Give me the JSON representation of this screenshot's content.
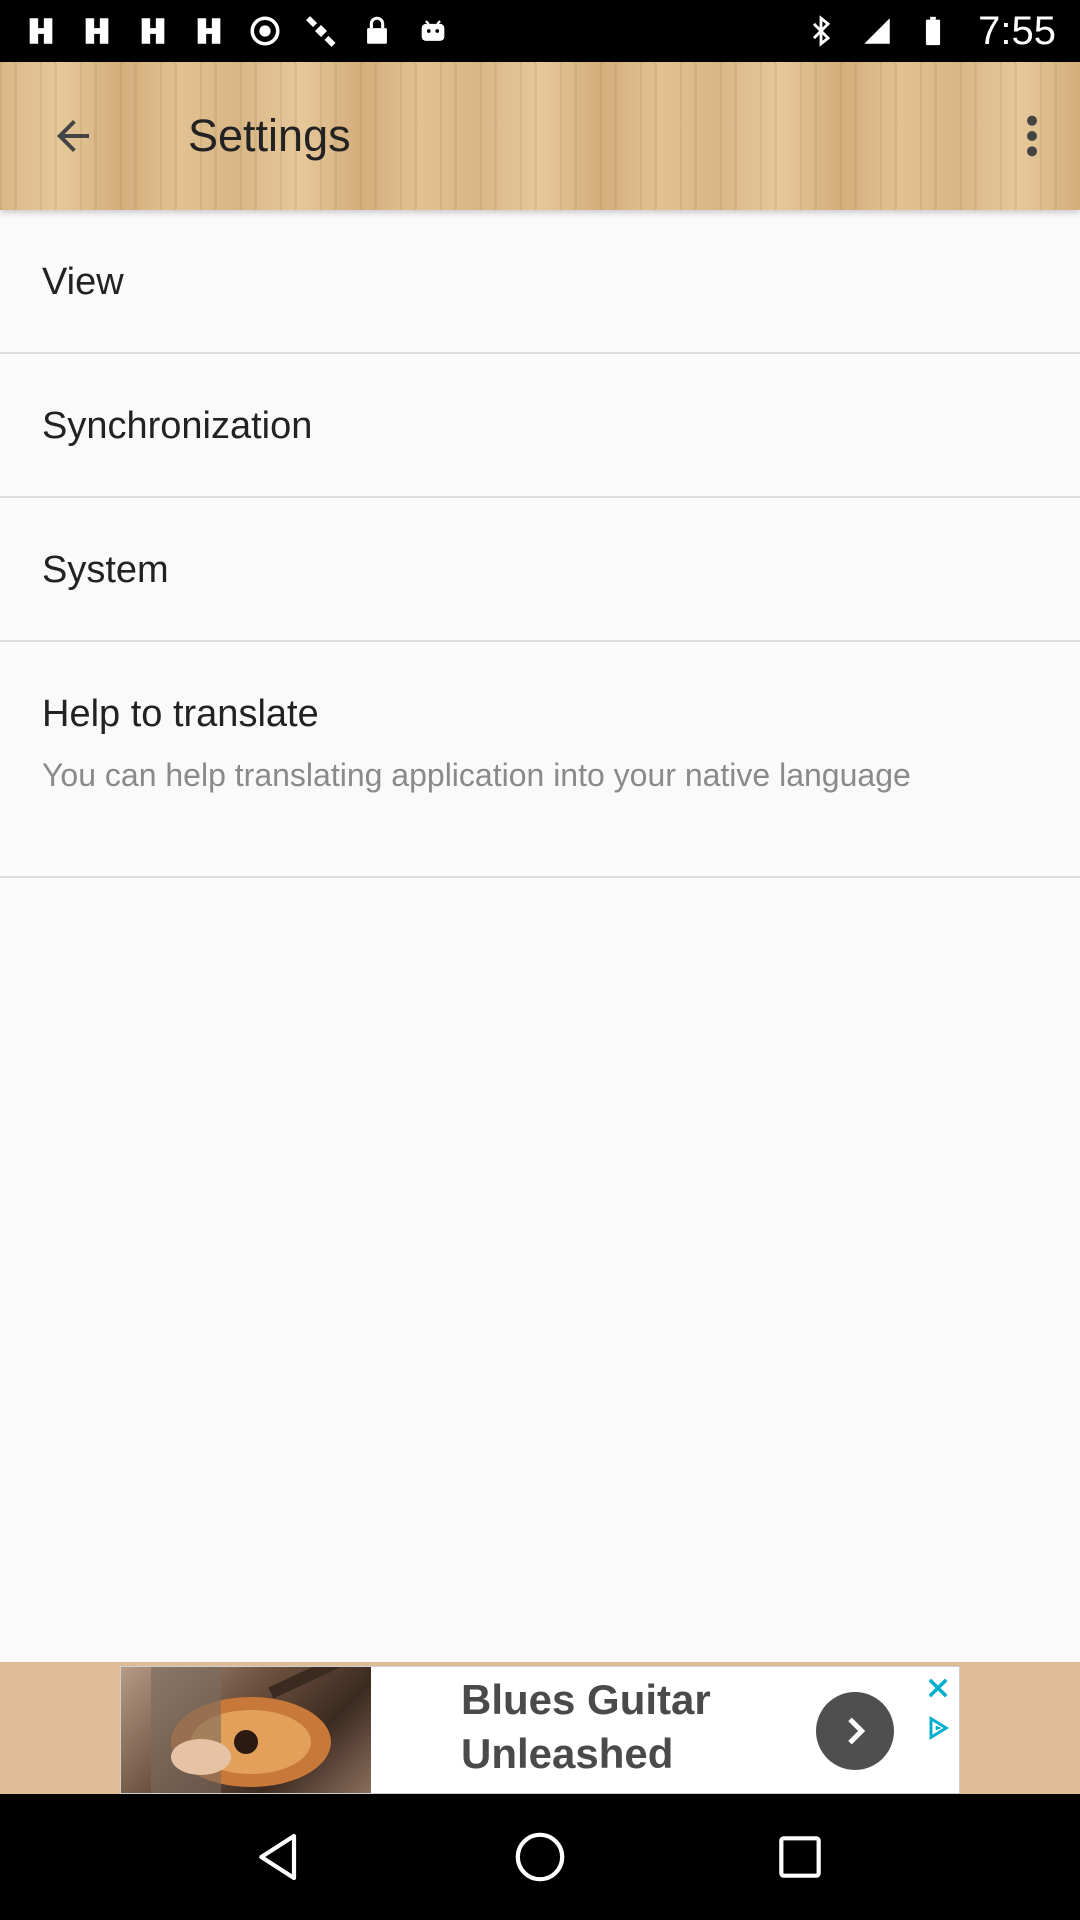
{
  "status_bar": {
    "time": "7:55",
    "left_icons": [
      "notification-icon",
      "notification-icon",
      "notification-icon",
      "notification-icon",
      "circle-notification-icon",
      "satellite-icon",
      "lock-icon",
      "android-icon"
    ],
    "right_icons": [
      "bluetooth-icon",
      "signal-icon",
      "battery-icon"
    ]
  },
  "app_bar": {
    "title": "Settings"
  },
  "settings": {
    "items": [
      {
        "label": "View"
      },
      {
        "label": "Synchronization"
      },
      {
        "label": "System"
      },
      {
        "label": "Help to translate",
        "summary": "You can help translating application into your native language"
      }
    ]
  },
  "ad": {
    "text": "Blues Guitar Unleashed",
    "accent": "#4f4f4f",
    "choices_color": "#00aecd"
  },
  "colors": {
    "background": "#fafafa",
    "divider": "#dcdcdc",
    "wood": "#ddb989",
    "ad_strip": "#ddbc96"
  }
}
